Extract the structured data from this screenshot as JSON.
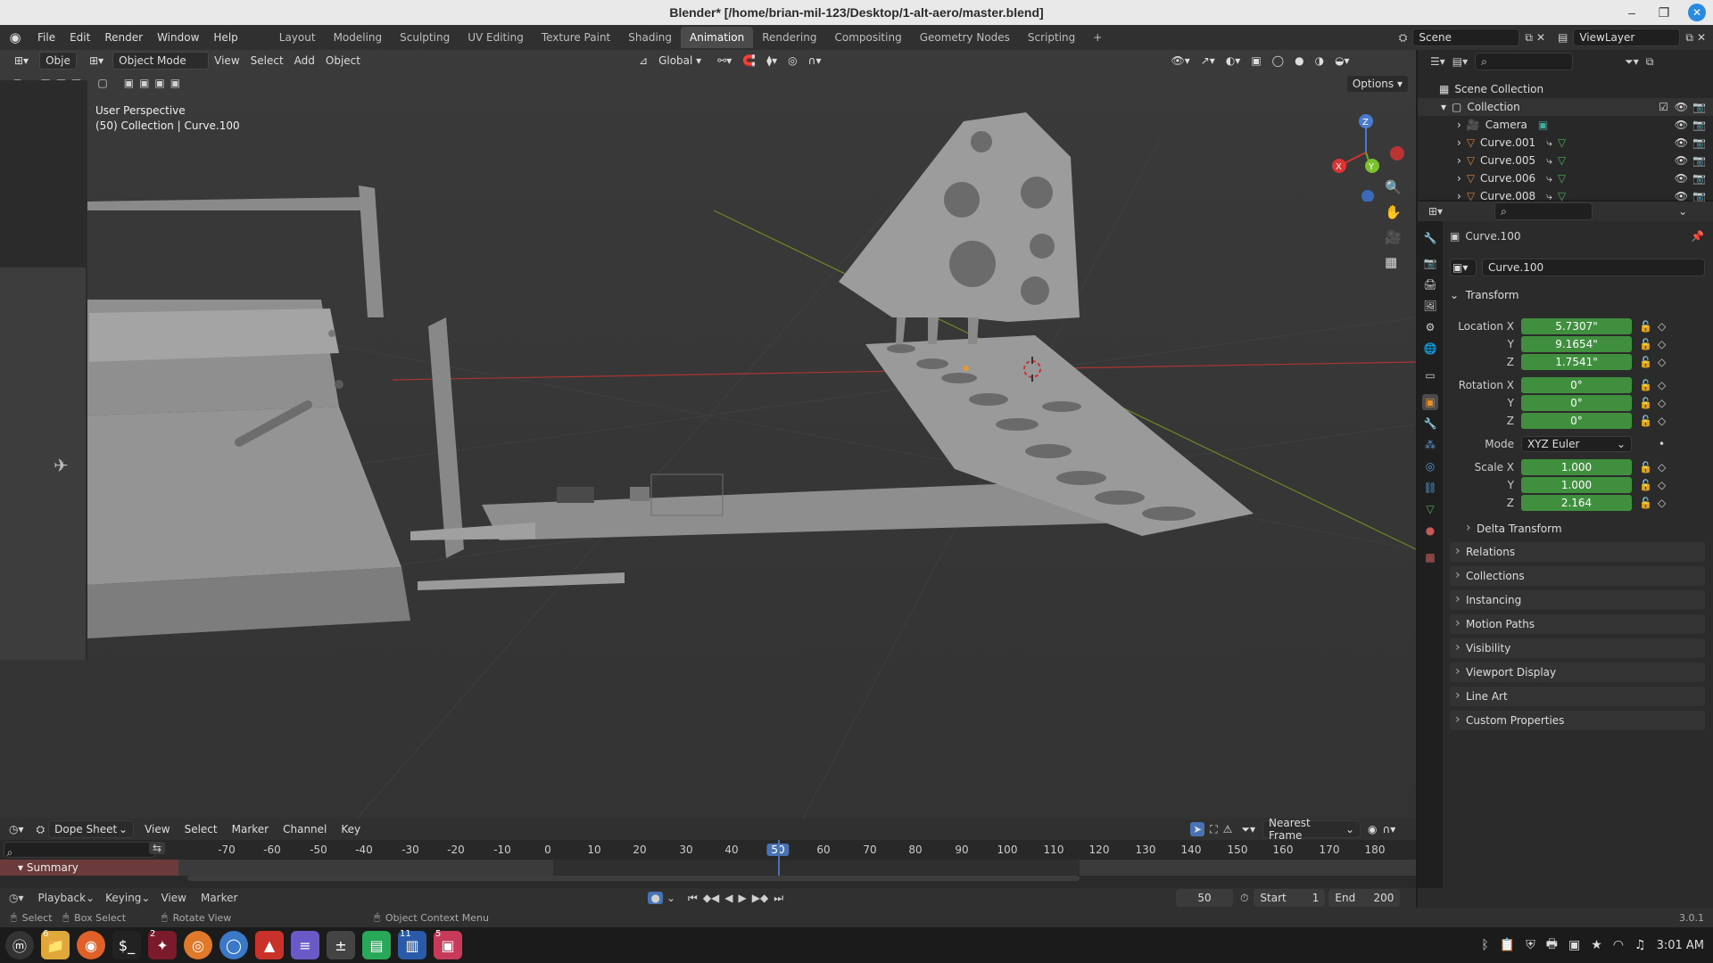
{
  "title": "Blender* [/home/brian-mil-123/Desktop/1-alt-aero/master.blend]",
  "menu": [
    "File",
    "Edit",
    "Render",
    "Window",
    "Help"
  ],
  "workspaces": [
    "Layout",
    "Modeling",
    "Sculpting",
    "UV Editing",
    "Texture Paint",
    "Shading",
    "Animation",
    "Rendering",
    "Compositing",
    "Geometry Nodes",
    "Scripting"
  ],
  "active_workspace": "Animation",
  "scene": "Scene",
  "viewlayer": "ViewLayer",
  "viewport": {
    "mode": "Object Mode",
    "obj_trunc": "Obje",
    "menus": [
      "View",
      "Select",
      "Add",
      "Object"
    ],
    "orientation": "Global",
    "options": "Options",
    "perspective": "User Perspective",
    "info": "(50) Collection | Curve.100",
    "gizmo": {
      "x": "X",
      "y": "Y",
      "z": "Z"
    }
  },
  "outliner": {
    "root": "Scene Collection",
    "collection": "Collection",
    "items": [
      "Camera",
      "Curve.001",
      "Curve.005",
      "Curve.006",
      "Curve.008"
    ]
  },
  "properties": {
    "object_name": "Curve.100",
    "datablock": "Curve.100",
    "transform_label": "Transform",
    "location": {
      "label": "Location X",
      "x": "5.7307\"",
      "y": "9.1654\"",
      "z": "1.7541\""
    },
    "rotation": {
      "label": "Rotation X",
      "x": "0°",
      "y": "0°",
      "z": "0°"
    },
    "mode_label": "Mode",
    "mode_value": "XYZ Euler",
    "scale": {
      "label": "Scale X",
      "x": "1.000",
      "y": "1.000",
      "z": "2.164"
    },
    "axis_y": "Y",
    "axis_z": "Z",
    "delta": "Delta Transform",
    "panels": [
      "Relations",
      "Collections",
      "Instancing",
      "Motion Paths",
      "Visibility",
      "Viewport Display",
      "Line Art",
      "Custom Properties"
    ]
  },
  "dopesheet": {
    "editor": "Dope Sheet",
    "menus": [
      "View",
      "Select",
      "Marker",
      "Channel",
      "Key"
    ],
    "snap": "Nearest Frame",
    "ticks": [
      "-70",
      "-60",
      "-50",
      "-40",
      "-30",
      "-20",
      "-10",
      "0",
      "10",
      "20",
      "30",
      "40",
      "50",
      "60",
      "70",
      "80",
      "90",
      "100",
      "110",
      "120",
      "130",
      "140",
      "150",
      "160",
      "170",
      "180"
    ],
    "current_frame": "50",
    "summary": "Summary"
  },
  "playback": {
    "menus": [
      "Playback",
      "Keying",
      "View",
      "Marker"
    ],
    "frame": "50",
    "start_label": "Start",
    "start": "1",
    "end_label": "End",
    "end": "200"
  },
  "status": {
    "select": "Select",
    "box_select": "Box Select",
    "rotate": "Rotate View",
    "context": "Object Context Menu",
    "version": "3.0.1"
  },
  "taskbar": {
    "clock": "3:01 AM",
    "badges": [
      "6",
      "2",
      "11",
      "5"
    ]
  },
  "colors": {
    "accent": "#4772b3",
    "green_field": "#3f8f3f",
    "active_frame": "#4772b3"
  }
}
